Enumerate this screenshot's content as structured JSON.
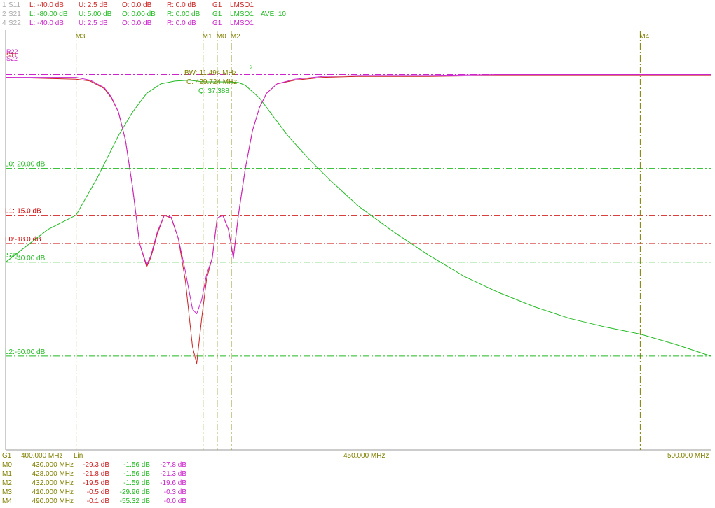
{
  "colors": {
    "s11": "#cc2222",
    "s21": "#22bb22",
    "s22": "#cc22cc",
    "marker": "#808000",
    "header_dim": "#aaaaaa",
    "limit_red": "#cc0000",
    "limit_green": "#22bb22"
  },
  "header": [
    {
      "id": "1",
      "name": "S11",
      "L": "L: -40.0 dB",
      "U": "U: 2.5 dB",
      "O": "O: 0.0 dB",
      "R": "R: 0.0 dB",
      "G": "G1",
      "src": "LMSO1",
      "extra": ""
    },
    {
      "id": "2",
      "name": "S21",
      "L": "L: -80.00 dB",
      "U": "U: 5.00 dB",
      "O": "O: 0.00 dB",
      "R": "R: 0.00 dB",
      "G": "G1",
      "src": "LMSO1",
      "extra": "AVE: 10"
    },
    {
      "id": "4",
      "name": "S22",
      "L": "L: -40.0 dB",
      "U": "U: 2.5 dB",
      "O": "O: 0.0 dB",
      "R": "R: 0.0 dB",
      "G": "G1",
      "src": "LMSO1",
      "extra": ""
    }
  ],
  "footer": {
    "group": "G1",
    "start": "400.000 MHz",
    "scale": "Lin",
    "center": "450.000 MHz",
    "stop": "500.000 MHz",
    "markers": [
      {
        "name": "M0",
        "freq": "430.000 MHz",
        "s11": "-29.3 dB",
        "s21": "-1.56 dB",
        "s22": "-27.8 dB"
      },
      {
        "name": "M1",
        "freq": "428.000 MHz",
        "s11": "-21.8 dB",
        "s21": "-1.56 dB",
        "s22": "-21.3 dB"
      },
      {
        "name": "M2",
        "freq": "432.000 MHz",
        "s11": "-19.5 dB",
        "s21": "-1.59 dB",
        "s22": "-19.6 dB"
      },
      {
        "name": "M3",
        "freq": "410.000 MHz",
        "s11": "-0.5 dB",
        "s21": "-29.96 dB",
        "s22": "-0.3 dB"
      },
      {
        "name": "M4",
        "freq": "490.000 MHz",
        "s11": "-0.1 dB",
        "s21": "-55.32 dB",
        "s22": "-0.0 dB"
      }
    ]
  },
  "annotations": {
    "bw": "BW: 11.494 MHz",
    "center": "C: 429.724 MHz",
    "q": "Q: 37.388"
  },
  "trace_labels": {
    "s11": "S11",
    "s22": "S22",
    "s21": "S21",
    "r22": "R22"
  },
  "chart_data": {
    "type": "line",
    "x_unit": "MHz",
    "xlim": [
      400,
      500
    ],
    "x_ticks": [
      "400.000 MHz",
      "450.000 MHz",
      "500.000 MHz"
    ],
    "scale": "Lin",
    "series": [
      {
        "name": "S11",
        "unit": "dB",
        "ylim": [
          -40,
          2.5
        ],
        "points": [
          [
            400,
            -0.3
          ],
          [
            405,
            -0.4
          ],
          [
            410,
            -0.5
          ],
          [
            412,
            -0.7
          ],
          [
            414,
            -1.5
          ],
          [
            415,
            -2.5
          ],
          [
            416,
            -4
          ],
          [
            417,
            -7
          ],
          [
            418,
            -12
          ],
          [
            419,
            -18
          ],
          [
            420,
            -20.5
          ],
          [
            420.6,
            -19.5
          ],
          [
            421.5,
            -17
          ],
          [
            422.5,
            -15
          ],
          [
            423.5,
            -15.3
          ],
          [
            424.5,
            -17.5
          ],
          [
            425.5,
            -22
          ],
          [
            426.5,
            -29
          ],
          [
            427.1,
            -30.8
          ],
          [
            427.8,
            -26
          ],
          [
            428.5,
            -21.8
          ],
          [
            429.3,
            -19.5
          ],
          [
            430,
            -15.3
          ],
          [
            430.8,
            -15
          ],
          [
            431.6,
            -16.5
          ],
          [
            432.3,
            -19.5
          ],
          [
            433,
            -15
          ],
          [
            434,
            -10
          ],
          [
            435,
            -6
          ],
          [
            436,
            -3.5
          ],
          [
            437,
            -2
          ],
          [
            438.5,
            -1
          ],
          [
            441,
            -0.6
          ],
          [
            445,
            -0.3
          ],
          [
            450,
            -0.2
          ],
          [
            460,
            -0.2
          ],
          [
            470,
            -0.1
          ],
          [
            480,
            -0.1
          ],
          [
            490,
            -0.1
          ],
          [
            500,
            -0.1
          ]
        ]
      },
      {
        "name": "S21",
        "unit": "dB",
        "ylim": [
          -80,
          5
        ],
        "points": [
          [
            400,
            -40
          ],
          [
            403,
            -36.5
          ],
          [
            406,
            -33
          ],
          [
            410,
            -29.96
          ],
          [
            413,
            -22
          ],
          [
            416,
            -13
          ],
          [
            418,
            -8
          ],
          [
            420,
            -4
          ],
          [
            422,
            -2
          ],
          [
            424,
            -1.4
          ],
          [
            426,
            -1.2
          ],
          [
            428,
            -1.56
          ],
          [
            430,
            -1.56
          ],
          [
            432,
            -1.59
          ],
          [
            433,
            -1.7
          ],
          [
            434,
            -2.3
          ],
          [
            436,
            -5
          ],
          [
            438,
            -9
          ],
          [
            440,
            -13
          ],
          [
            443,
            -18
          ],
          [
            446,
            -22.5
          ],
          [
            450,
            -28
          ],
          [
            455,
            -33.5
          ],
          [
            460,
            -38.5
          ],
          [
            465,
            -43
          ],
          [
            470,
            -46.5
          ],
          [
            475,
            -49.5
          ],
          [
            480,
            -52
          ],
          [
            485,
            -53.8
          ],
          [
            490,
            -55.32
          ],
          [
            495,
            -57.5
          ],
          [
            500,
            -60
          ]
        ]
      },
      {
        "name": "S22",
        "unit": "dB",
        "ylim": [
          -40,
          2.5
        ],
        "points": [
          [
            400,
            -0.3
          ],
          [
            405,
            -0.3
          ],
          [
            410,
            -0.3
          ],
          [
            412,
            -0.6
          ],
          [
            414,
            -1.4
          ],
          [
            415,
            -2.4
          ],
          [
            416,
            -4
          ],
          [
            417,
            -7
          ],
          [
            418,
            -12
          ],
          [
            419,
            -18
          ],
          [
            420,
            -20.3
          ],
          [
            420.6,
            -19.3
          ],
          [
            421.5,
            -16.8
          ],
          [
            422.5,
            -15
          ],
          [
            423.5,
            -15.2
          ],
          [
            424.5,
            -17.5
          ],
          [
            425.5,
            -21
          ],
          [
            426.5,
            -25
          ],
          [
            427.1,
            -25.5
          ],
          [
            427.8,
            -24
          ],
          [
            428.5,
            -21.3
          ],
          [
            429.3,
            -19.6
          ],
          [
            430,
            -15.3
          ],
          [
            430.8,
            -15
          ],
          [
            431.6,
            -16.5
          ],
          [
            432.3,
            -19.6
          ],
          [
            433,
            -15
          ],
          [
            434,
            -10
          ],
          [
            435,
            -6
          ],
          [
            436,
            -3.5
          ],
          [
            437,
            -2
          ],
          [
            438.5,
            -1
          ],
          [
            441,
            -0.5
          ],
          [
            445,
            -0.2
          ],
          [
            450,
            -0.1
          ],
          [
            460,
            -0.1
          ],
          [
            470,
            0
          ],
          [
            480,
            0
          ],
          [
            490,
            0
          ],
          [
            500,
            0
          ]
        ]
      }
    ],
    "markers": [
      {
        "name": "M0",
        "x": 430
      },
      {
        "name": "M1",
        "x": 428
      },
      {
        "name": "M2",
        "x": 432
      },
      {
        "name": "M3",
        "x": 410
      },
      {
        "name": "M4",
        "x": 490
      }
    ],
    "limit_lines": [
      {
        "label": "L0:-20.00 dB",
        "series": "S21",
        "value": -20,
        "color": "green"
      },
      {
        "label": "L1:-15.0 dB",
        "series": "S11",
        "value": -15,
        "color": "red"
      },
      {
        "label": "L0:-18.0 dB",
        "series": "S11",
        "value": -18,
        "color": "red"
      },
      {
        "label": "L1:-40.00 dB",
        "series": "S21",
        "value": -40,
        "color": "green"
      },
      {
        "label": "L2:-60.00 dB",
        "series": "S21",
        "value": -60,
        "color": "green"
      }
    ],
    "reference_line": {
      "series": "S22",
      "value": 0
    }
  }
}
